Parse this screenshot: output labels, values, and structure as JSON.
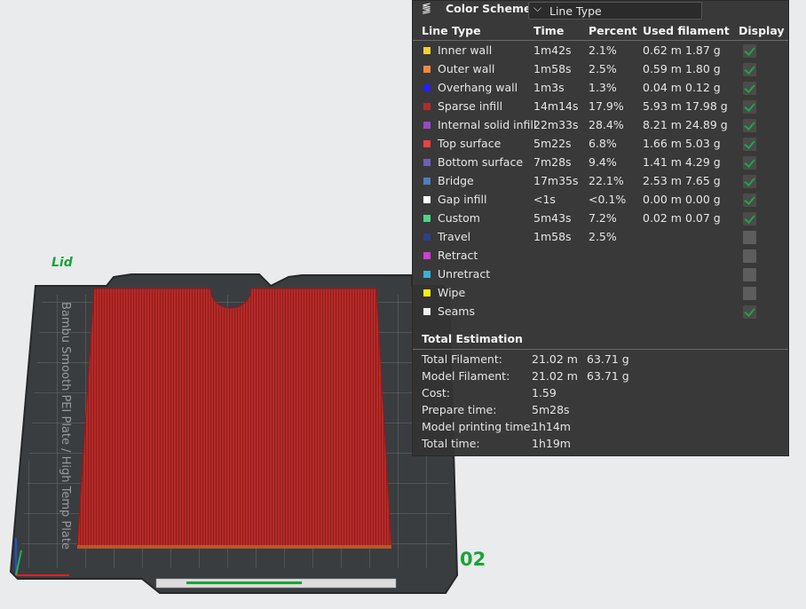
{
  "plate": {
    "name": "Lid",
    "number": "02"
  },
  "panel": {
    "title": "Color Scheme",
    "scheme_value": "Line Type",
    "headers": {
      "line_type": "Line Type",
      "time": "Time",
      "percent": "Percent",
      "used_filament": "Used filament",
      "display": "Display"
    },
    "rows": [
      {
        "label": "Inner wall",
        "color": "#f5cf3a",
        "time": "1m42s",
        "percent": "2.1%",
        "length": "0.62 m",
        "weight": "1.87 g",
        "checked": true
      },
      {
        "label": "Outer wall",
        "color": "#f28a3c",
        "time": "1m58s",
        "percent": "2.5%",
        "length": "0.59 m",
        "weight": "1.80 g",
        "checked": true
      },
      {
        "label": "Overhang wall",
        "color": "#2622f0",
        "time": "1m3s",
        "percent": "1.3%",
        "length": "0.04 m",
        "weight": "0.12 g",
        "checked": true
      },
      {
        "label": "Sparse infill",
        "color": "#b42a2a",
        "time": "14m14s",
        "percent": "17.9%",
        "length": "5.93 m",
        "weight": "17.98 g",
        "checked": true
      },
      {
        "label": "Internal solid infill",
        "color": "#9a48c4",
        "time": "22m33s",
        "percent": "28.4%",
        "length": "8.21 m",
        "weight": "24.89 g",
        "checked": true
      },
      {
        "label": "Top surface",
        "color": "#f04040",
        "time": "5m22s",
        "percent": "6.8%",
        "length": "1.66 m",
        "weight": "5.03 g",
        "checked": true
      },
      {
        "label": "Bottom surface",
        "color": "#6e5fb7",
        "time": "7m28s",
        "percent": "9.4%",
        "length": "1.41 m",
        "weight": "4.29 g",
        "checked": true
      },
      {
        "label": "Bridge",
        "color": "#4f7ec2",
        "time": "17m35s",
        "percent": "22.1%",
        "length": "2.53 m",
        "weight": "7.65 g",
        "checked": true
      },
      {
        "label": "Gap infill",
        "color": "#ffffff",
        "time": "<1s",
        "percent": "<0.1%",
        "length": "0.00 m",
        "weight": "0.00 g",
        "checked": true
      },
      {
        "label": "Custom",
        "color": "#4fd28a",
        "time": "5m43s",
        "percent": "7.2%",
        "length": "0.02 m",
        "weight": "0.07 g",
        "checked": true
      },
      {
        "label": "Travel",
        "color": "#2e3f8f",
        "time": "1m58s",
        "percent": "2.5%",
        "length": "",
        "weight": "",
        "checked": false
      },
      {
        "label": "Retract",
        "color": "#d43cd4",
        "time": "",
        "percent": "",
        "length": "",
        "weight": "",
        "checked": false
      },
      {
        "label": "Unretract",
        "color": "#3ab0d6",
        "time": "",
        "percent": "",
        "length": "",
        "weight": "",
        "checked": false
      },
      {
        "label": "Wipe",
        "color": "#f5f012",
        "time": "",
        "percent": "",
        "length": "",
        "weight": "",
        "checked": false
      },
      {
        "label": "Seams",
        "color": "#f0f0f0",
        "time": "",
        "percent": "",
        "length": "",
        "weight": "",
        "checked": true
      }
    ],
    "estimation": {
      "title": "Total Estimation",
      "rows": [
        {
          "label": "Total Filament:",
          "v1": "21.02 m",
          "v2": "63.71 g"
        },
        {
          "label": "Model Filament:",
          "v1": "21.02 m",
          "v2": "63.71 g"
        },
        {
          "label": "Cost:",
          "v1": "1.59",
          "v2": ""
        },
        {
          "label": "Prepare time:",
          "v1": "5m28s",
          "v2": ""
        },
        {
          "label": "Model printing time:",
          "v1": "1h14m",
          "v2": ""
        },
        {
          "label": "Total time:",
          "v1": "1h19m",
          "v2": ""
        }
      ]
    }
  }
}
